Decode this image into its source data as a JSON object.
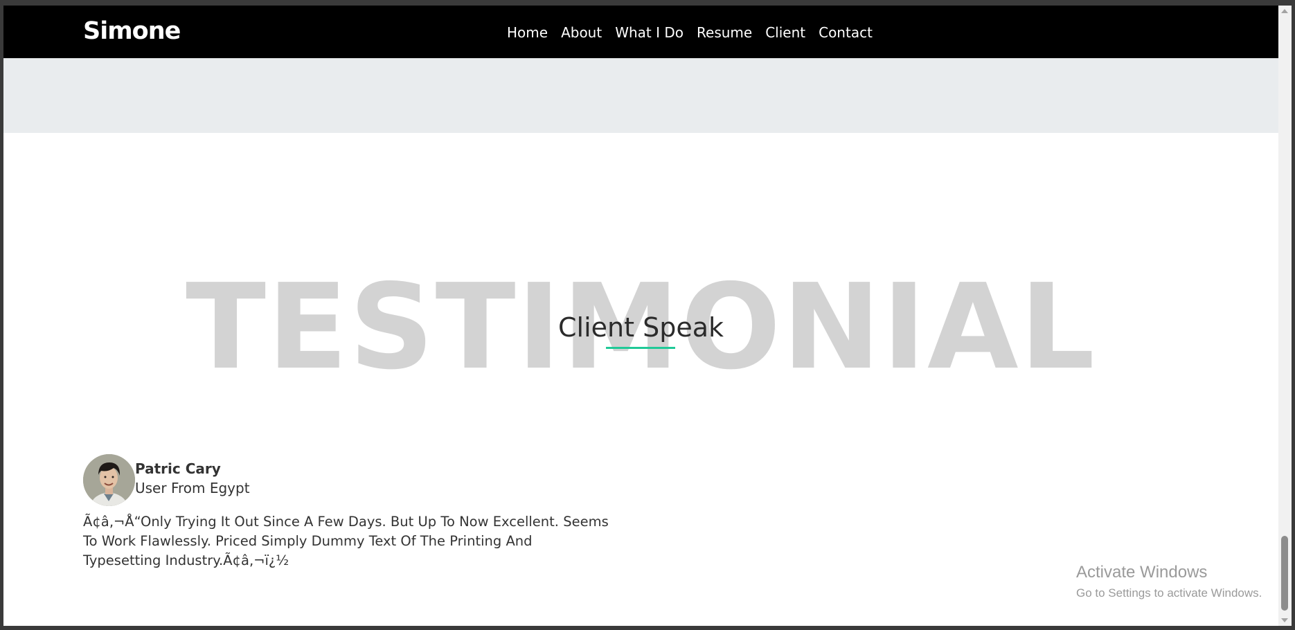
{
  "navbar": {
    "brand": "Simone",
    "links": [
      "Home",
      "About",
      "What I Do",
      "Resume",
      "Client",
      "Contact"
    ]
  },
  "section": {
    "watermark": "TESTIMONIAL",
    "title": "Client Speak",
    "accent_color": "#20c997"
  },
  "testimonial": {
    "avatar_icon": "client-avatar-photo",
    "name": "Patric Cary",
    "location": "User From Egypt",
    "quote": "Ã¢â‚¬Å“Only Trying It Out Since A Few Days. But Up To Now Excellent. Seems To Work Flawlessly. Priced Simply Dummy Text Of The Printing And Typesetting Industry.Ã¢â‚¬ï¿½"
  },
  "windows_notice": {
    "title": "Activate Windows",
    "subtitle": "Go to Settings to activate Windows."
  }
}
